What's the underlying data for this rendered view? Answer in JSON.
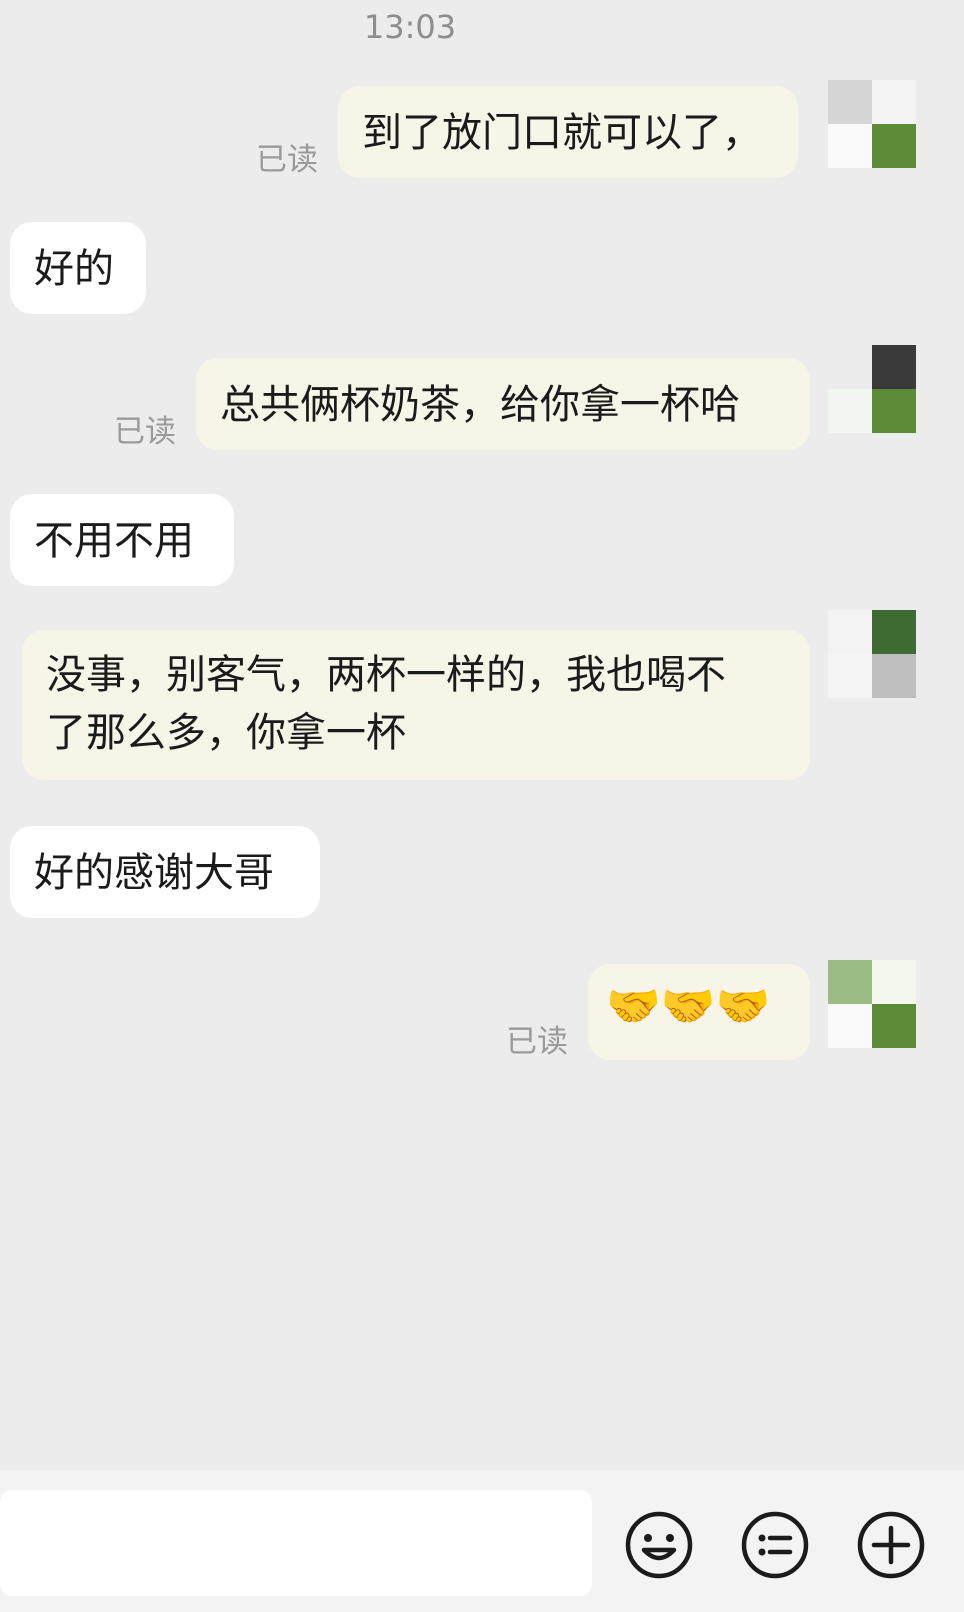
{
  "header": {
    "time": "13:03"
  },
  "messages": [
    {
      "side": "me",
      "text": "到了放门口就可以了，",
      "status": "已读"
    },
    {
      "side": "them",
      "text": "好的"
    },
    {
      "side": "me",
      "text": "总共俩杯奶茶，给你拿一杯哈",
      "status": "已读"
    },
    {
      "side": "them",
      "text": "不用不用"
    },
    {
      "side": "me",
      "line1": "没事，别客气，两杯一样的，我也喝不",
      "line2": "了那么多，你拿一杯"
    },
    {
      "side": "them",
      "text": "好的感谢大哥"
    },
    {
      "side": "me",
      "emoji": "🤝🤝🤝",
      "emoji_name": "handshake x3",
      "status": "已读"
    }
  ],
  "input": {
    "placeholder": ""
  },
  "toolbar": {
    "emoji_icon": "smiley-face-icon",
    "quick_reply_icon": "list-circle-icon",
    "more_icon": "plus-circle-icon"
  },
  "colors": {
    "background": "#ececec",
    "bubble_me": "#f7f5e7",
    "bubble_them": "#ffffff",
    "avatar_green": "#5b8b37"
  }
}
